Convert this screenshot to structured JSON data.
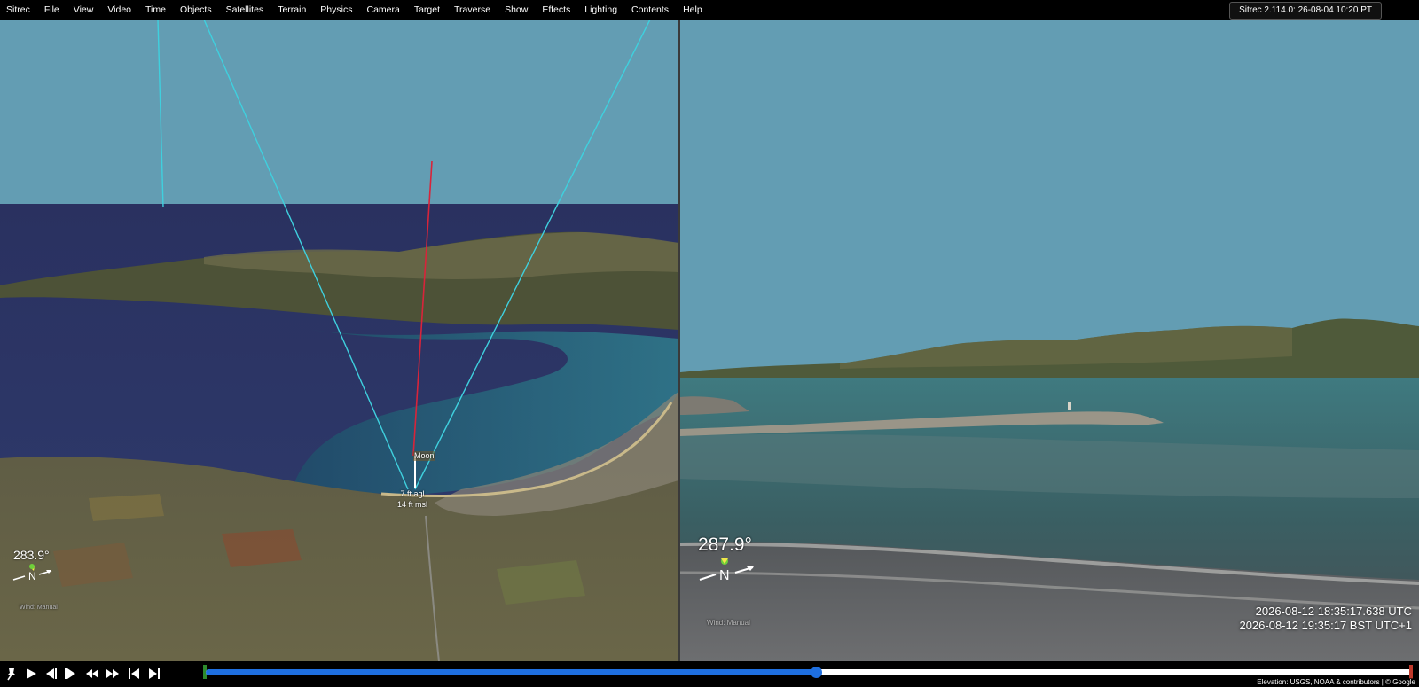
{
  "menubar": {
    "items": [
      "Sitrec",
      "File",
      "View",
      "Video",
      "Time",
      "Objects",
      "Satellites",
      "Terrain",
      "Physics",
      "Camera",
      "Target",
      "Traverse",
      "Show",
      "Effects",
      "Lighting",
      "Contents",
      "Help"
    ],
    "version": "Sitrec 2.114.0: 26-08-04 10:20 PT"
  },
  "left_view": {
    "heading": "283.9°",
    "north_label": "N",
    "wind_label": "Wind: Manual",
    "moon_label": "Moon",
    "altitude_agl": "7 ft agl",
    "altitude_msl": "14 ft msl"
  },
  "right_view": {
    "heading": "287.9°",
    "north_label": "N",
    "wind_label": "Wind: Manual",
    "time_utc": "2026-08-12 18:35:17.638 UTC",
    "time_local": "2026-08-12 19:35:17 BST UTC+1"
  },
  "timeline": {
    "progress": 0.506
  },
  "controls": {
    "icons": [
      "pin-icon",
      "play-icon",
      "step-back-icon",
      "step-forward-icon",
      "rewind-icon",
      "fast-forward-icon",
      "skip-start-icon",
      "skip-end-icon"
    ]
  },
  "attribution": "Elevation: USGS, NOAA & contributors | © Google",
  "colors": {
    "sky": "#639db3",
    "sea_deep": "#2b3566",
    "frustum": "#3fd0de",
    "look_line": "#d8243a",
    "timeline": "#1e6fe0"
  }
}
